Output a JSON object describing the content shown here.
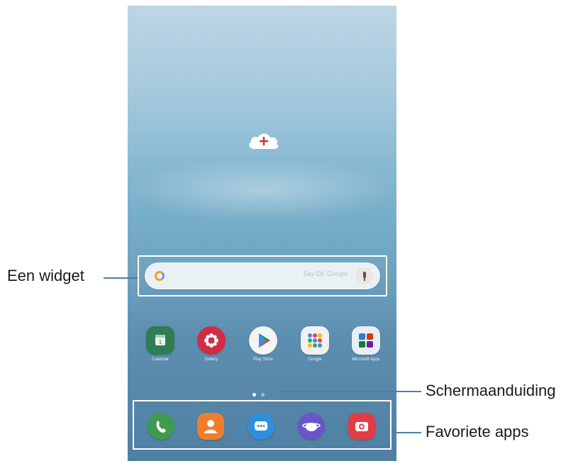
{
  "callouts": {
    "widget": "Een widget",
    "page_indicator": "Schermaanduiding",
    "favorites": "Favoriete apps"
  },
  "widget": {
    "placeholder": "Say OK Google",
    "google_icon": "google-g-icon",
    "mic_icon": "mic-icon"
  },
  "home_apps": [
    {
      "icon": "calendar-icon",
      "label": "Calendar",
      "color": "#2f7d54"
    },
    {
      "icon": "gallery-icon",
      "label": "Gallery",
      "color": "#d22c44"
    },
    {
      "icon": "play-store-icon",
      "label": "Play Store",
      "color": "#f4f4f4"
    },
    {
      "icon": "google-icon",
      "label": "Google",
      "color": "#f1f1f1"
    },
    {
      "icon": "microsoft-apps-icon",
      "label": "Microsoft Apps",
      "color": "#e8eef6"
    }
  ],
  "page_indicator": {
    "pages": 2,
    "active": 1
  },
  "favorite_apps": [
    {
      "icon": "phone-icon",
      "color": "#3f9a4d"
    },
    {
      "icon": "contacts-icon",
      "color": "#ef7d2b"
    },
    {
      "icon": "messages-icon",
      "color": "#2f8fdc"
    },
    {
      "icon": "internet-icon",
      "color": "#6a56c8"
    },
    {
      "icon": "camera-icon",
      "color": "#e23c45"
    }
  ],
  "colors": {
    "frame": "#ffffff",
    "callout_line": "#4a7fa8"
  }
}
